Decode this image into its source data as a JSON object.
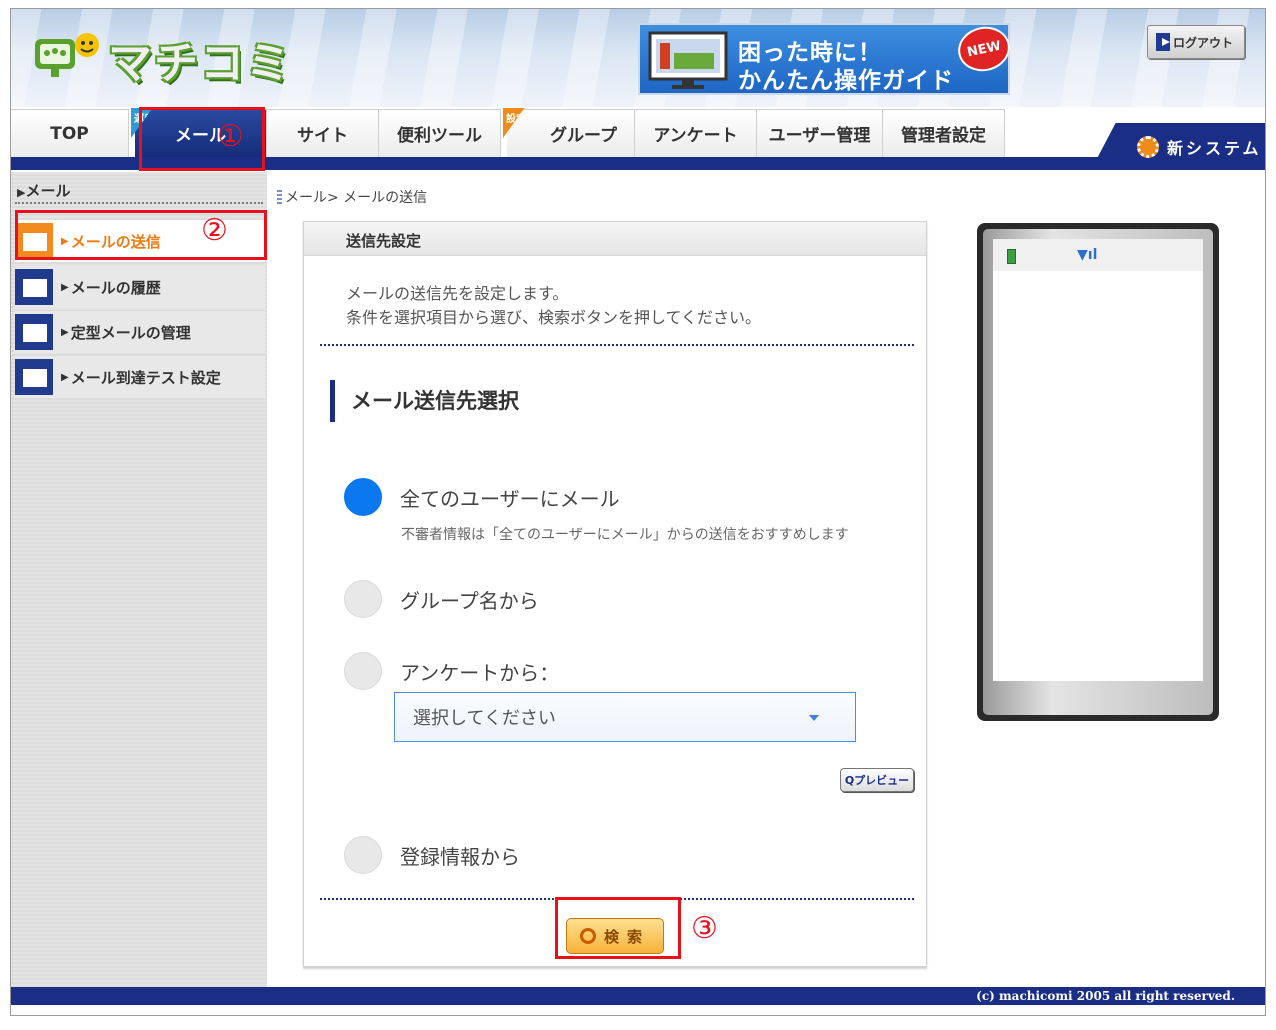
{
  "header": {
    "logo_text": "マチコミ",
    "guide_line1": "困った時に！",
    "guide_line2": "かんたん操作ガイド",
    "new_badge": "NEW",
    "logout_label": "ログアウト"
  },
  "nav": {
    "tabs": [
      {
        "label": "TOP",
        "ribbon": ""
      },
      {
        "label": "メール",
        "ribbon": "運用"
      },
      {
        "label": "サイト",
        "ribbon": ""
      },
      {
        "label": "便利ツール",
        "ribbon": ""
      },
      {
        "label": "グループ",
        "ribbon": "設定"
      },
      {
        "label": "アンケート",
        "ribbon": ""
      },
      {
        "label": "ユーザー管理",
        "ribbon": ""
      },
      {
        "label": "管理者設定",
        "ribbon": ""
      }
    ],
    "new_system": "新システム"
  },
  "sidebar": {
    "heading": "メール",
    "items": [
      {
        "label": "メールの送信"
      },
      {
        "label": "メールの履歴"
      },
      {
        "label": "定型メールの管理"
      },
      {
        "label": " メール到達テスト設定"
      }
    ]
  },
  "breadcrumb": "メール> メールの送信",
  "panel": {
    "title": "送信先設定",
    "desc1": "メールの送信先を設定します。",
    "desc2": "条件を選択項目から選び、検索ボタンを押してください。",
    "section_title": "メール送信先選択",
    "options": [
      {
        "label": "全てのユーザーにメール"
      },
      {
        "label": "グループ名から"
      },
      {
        "label": "アンケートから："
      },
      {
        "label": "登録情報から"
      }
    ],
    "hint": "不審者情報は「全てのユーザーにメール」からの送信をおすすめします",
    "select_value": "選択してください",
    "preview_label": "Qプレビュー",
    "search_label": "検索"
  },
  "annotations": [
    "①",
    "②",
    "③"
  ],
  "footer": "(c) machicomi 2005 all right reserved.",
  "colors": {
    "brand_navy": "#1a2e86",
    "accent_orange": "#f07a10",
    "annotation_red": "#e8101a",
    "radio_selected": "#0b78f0"
  }
}
